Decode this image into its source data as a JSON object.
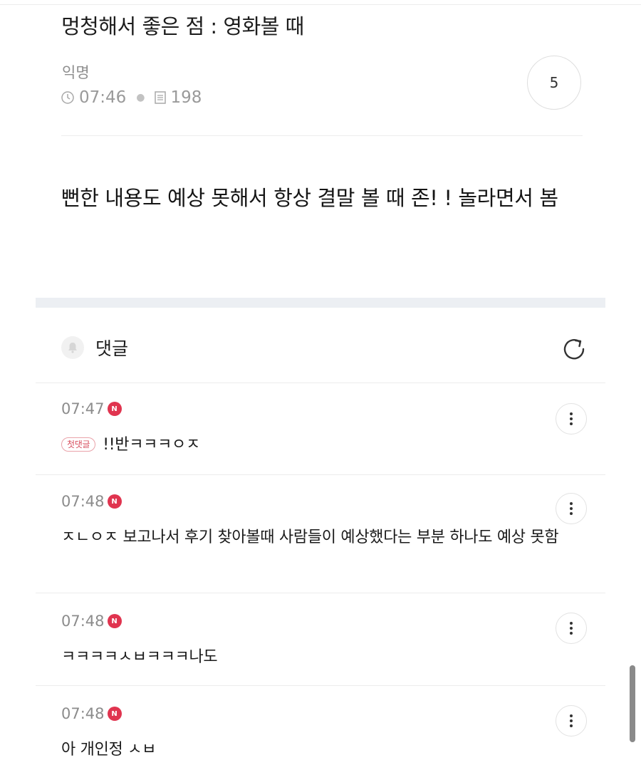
{
  "post": {
    "title": "멍청해서 좋은 점 : 영화볼 때",
    "author": "익명",
    "time": "07:46",
    "views": "198",
    "comment_count": "5",
    "body": "뻔한 내용도 예상 못해서 항상 결말 볼 때 존! ! 놀라면서 봄"
  },
  "comments_section": {
    "label": "댓글"
  },
  "comments": [
    {
      "time": "07:47",
      "badge": "첫댓글",
      "text": "!!반ㅋㅋㅋㅇㅈ"
    },
    {
      "time": "07:48",
      "text": "ㅈㄴㅇㅈ 보고나서 후기 찾아볼때 사람들이 예상했다는 부분 하나도 예상 못함"
    },
    {
      "time": "07:48",
      "text": "ㅋㅋㅋㅋㅅㅂㅋㅋㅋ나도"
    },
    {
      "time": "07:48",
      "text": "아 개인정 ㅅㅂ"
    }
  ],
  "icons": {
    "clock": "clock-icon",
    "views": "document-icon",
    "bell": "bell-icon",
    "refresh": "refresh-icon",
    "more": "more-vertical-icon",
    "new_badge": "new-badge-icon"
  },
  "colors": {
    "accent_red": "#e0344f",
    "meta_gray": "#9a9a9a"
  }
}
